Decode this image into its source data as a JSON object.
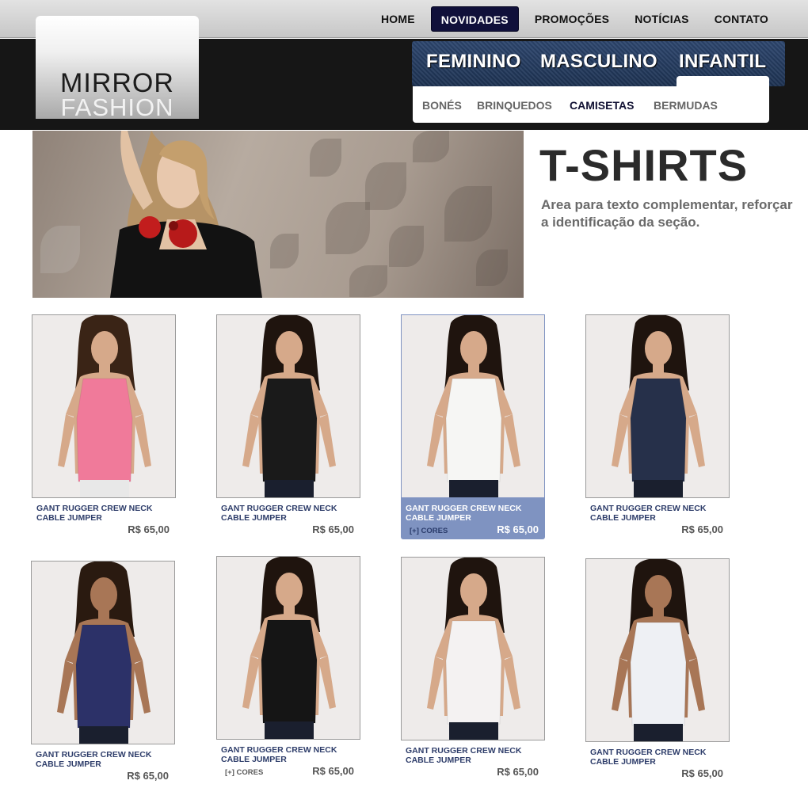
{
  "topnav": {
    "items": [
      {
        "label": "HOME",
        "active": false
      },
      {
        "label": "NOVIDADES",
        "active": true
      },
      {
        "label": "PROMOÇÕES",
        "active": false
      },
      {
        "label": "NOTÍCIAS",
        "active": false
      },
      {
        "label": "CONTATO",
        "active": false
      }
    ]
  },
  "logo": {
    "line1": "MIRROR",
    "line2": "FASHION"
  },
  "categories": {
    "items": [
      "FEMININO",
      "MASCULINO",
      "INFANTIL"
    ],
    "active": "INFANTIL"
  },
  "subcategories": {
    "items": [
      "BONÉS",
      "BRINQUEDOS",
      "CAMISETAS",
      "BERMUDAS"
    ],
    "active": "CAMISETAS"
  },
  "hero": {
    "title": "T-SHIRTS",
    "text": "Area para texto complementar, reforçar a identificação da seção."
  },
  "products": [
    {
      "name_line1": "GANT RUGGER CREW NECK",
      "name_line2": "CABLE JUMPER",
      "price": "R$ 65,00",
      "cores": "",
      "shirt_color": "#f07a9a",
      "hair": "#3a2416"
    },
    {
      "name_line1": "GANT RUGGER CREW NECK",
      "name_line2": "CABLE JUMPER",
      "price": "R$ 65,00",
      "cores": "",
      "shirt_color": "#1a1a1a",
      "hair": "#1f140e"
    },
    {
      "name_line1": "GANT RUGGER CREW NECK",
      "name_line2": "CABLE JUMPER",
      "price": "R$ 65,00",
      "cores": "[+] CORES",
      "shirt_color": "#f6f6f4",
      "hair": "#1f140e"
    },
    {
      "name_line1": "GANT RUGGER CREW NECK",
      "name_line2": "CABLE JUMPER",
      "price": "R$ 65,00",
      "cores": "",
      "shirt_color": "#26304a",
      "hair": "#1f140e"
    },
    {
      "name_line1": "GANT RUGGER CREW NECK",
      "name_line2": "CABLE JUMPER",
      "price": "R$ 65,00",
      "cores": "",
      "shirt_color": "#2c3168",
      "hair": "#2a1a10"
    },
    {
      "name_line1": "GANT RUGGER CREW NECK",
      "name_line2": "CABLE JUMPER",
      "price": "R$ 65,00",
      "cores": "[+] CORES",
      "shirt_color": "#151515",
      "hair": "#1f140e"
    },
    {
      "name_line1": "GANT RUGGER CREW NECK",
      "name_line2": "CABLE JUMPER",
      "price": "R$ 65,00",
      "cores": "",
      "shirt_color": "#f4f2f2",
      "hair": "#1f140e"
    },
    {
      "name_line1": "GANT RUGGER CREW NECK",
      "name_line2": "CABLE JUMPER",
      "price": "R$ 65,00",
      "cores": "",
      "shirt_color": "#eef0f4",
      "hair": "#1f140e"
    }
  ],
  "colors": {
    "accent_dark": "#10103a",
    "card_hover": "#7f93c1",
    "product_name": "#2e3d6a"
  }
}
